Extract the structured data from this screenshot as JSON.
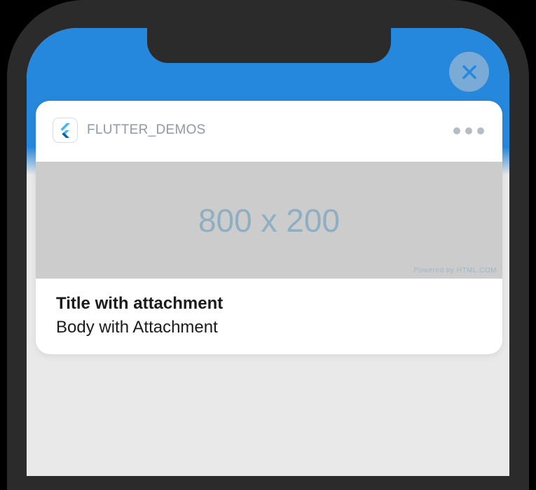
{
  "notification": {
    "app_name": "FLUTTER_DEMOS",
    "app_icon": "flutter-logo-icon",
    "image": {
      "label": "800 x 200",
      "powered_by": "Powered by HTML.COM"
    },
    "title": "Title with attachment",
    "body": "Body with Attachment"
  },
  "controls": {
    "close_icon": "close-icon",
    "more_icon": "more-options-icon"
  },
  "colors": {
    "header_blue": "#2688dc",
    "screen_bg": "#e9e9e9",
    "image_bg": "#cccccc",
    "image_text": "#8eaec1"
  }
}
